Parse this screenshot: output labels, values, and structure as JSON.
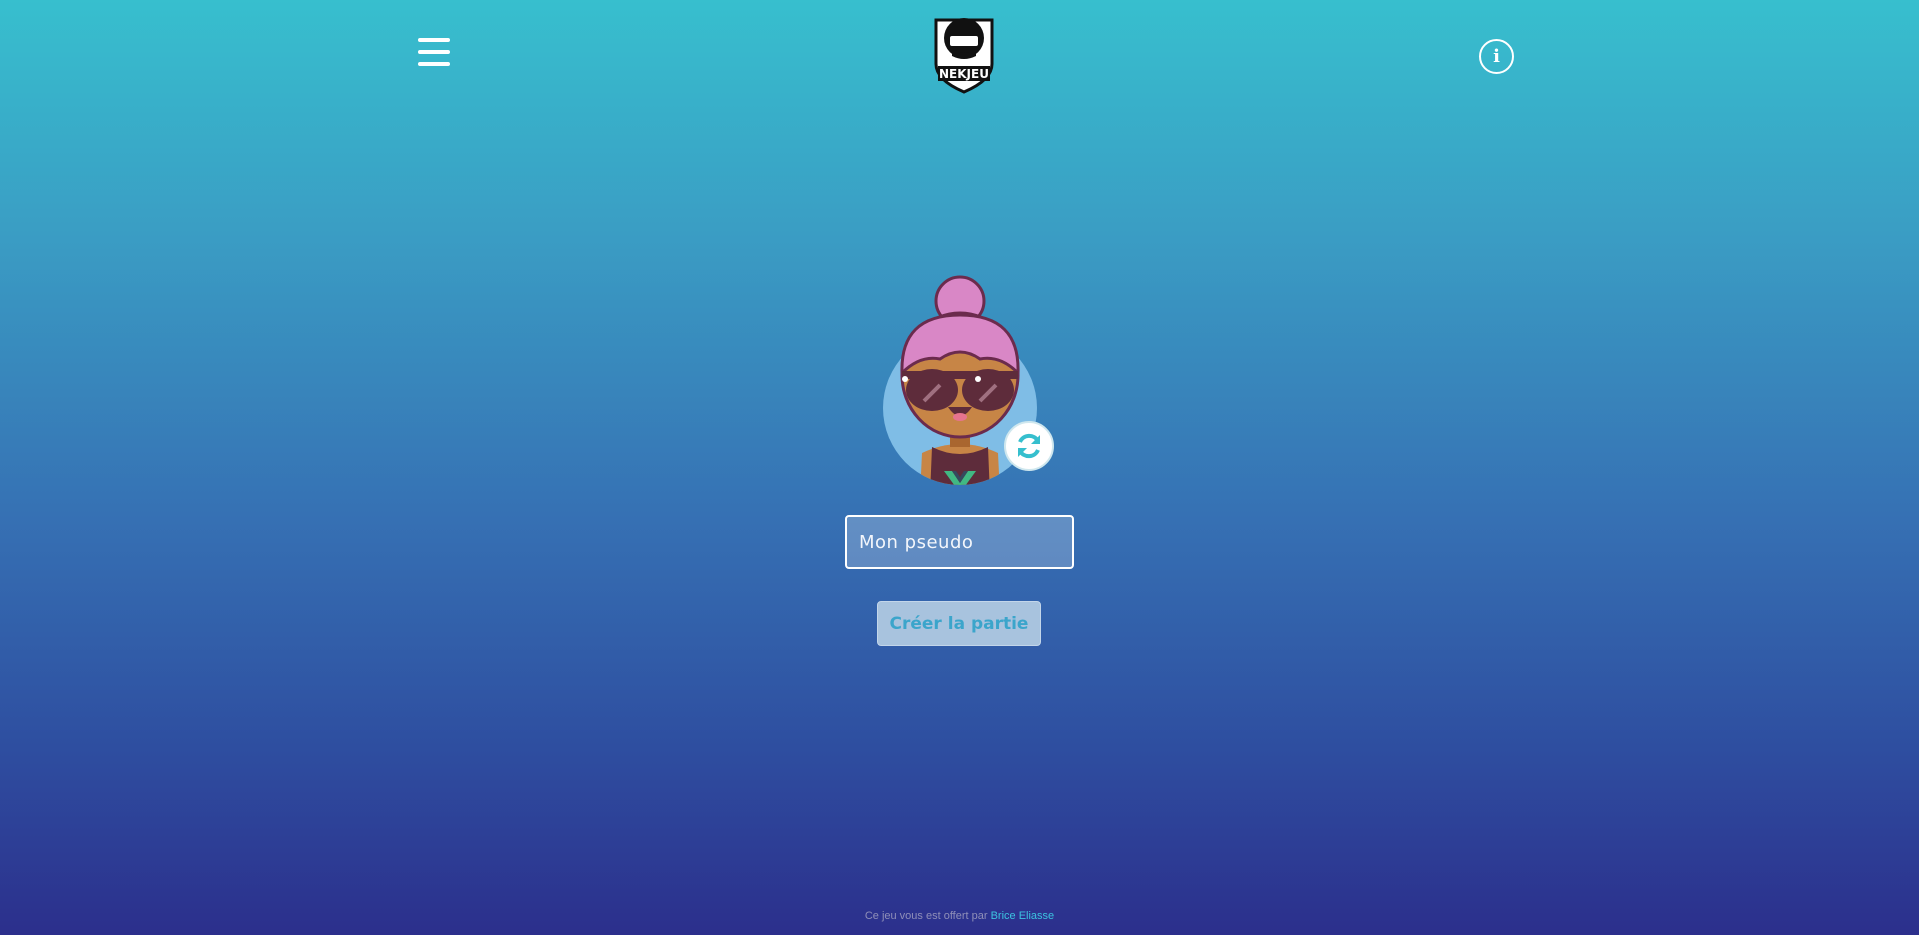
{
  "header": {
    "menu_icon": "hamburger-menu-icon",
    "logo_text": "NEKJEU",
    "info_icon": "info-icon",
    "info_glyph": "i"
  },
  "avatar": {
    "refresh_icon": "refresh-icon"
  },
  "form": {
    "pseudo_placeholder": "Mon pseudo",
    "pseudo_value": "",
    "create_label": "Créer la partie"
  },
  "footer": {
    "text": "Ce jeu vous est offert par",
    "author_link": "Brice Eliasse"
  },
  "colors": {
    "accent": "#3ba5cb",
    "gradient_top": "#37bfce",
    "gradient_bottom": "#2c2f8c"
  }
}
